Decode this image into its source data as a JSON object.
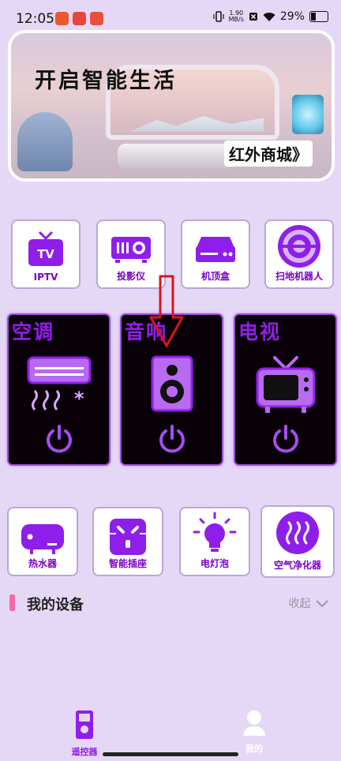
{
  "status": {
    "time": "12:05",
    "net_speed": "1.90",
    "net_unit": "MB/s",
    "battery": "29%"
  },
  "banner": {
    "title": "开启智能生活",
    "mall_link": "红外商城》"
  },
  "top_devices": [
    {
      "label": "IPTV",
      "icon": "tv-box-icon"
    },
    {
      "label": "投影仪",
      "icon": "projector-icon"
    },
    {
      "label": "机顶盒",
      "icon": "set-top-box-icon"
    },
    {
      "label": "扫地机器人",
      "icon": "robot-vacuum-icon"
    }
  ],
  "featured": [
    {
      "title": "空调",
      "icon": "air-conditioner-icon"
    },
    {
      "title": "音响",
      "icon": "speaker-icon"
    },
    {
      "title": "电视",
      "icon": "television-icon"
    }
  ],
  "bottom_devices": [
    {
      "label": "热水器",
      "icon": "water-heater-icon"
    },
    {
      "label": "智能插座",
      "icon": "smart-socket-icon"
    },
    {
      "label": "电灯泡",
      "icon": "light-bulb-icon"
    },
    {
      "label": "空气净化器",
      "icon": "air-purifier-icon"
    }
  ],
  "my_devices": {
    "title": "我的设备",
    "collapse_label": "收起"
  },
  "tabs": [
    {
      "label": "遥控器",
      "active": true
    },
    {
      "label": "我的",
      "active": false
    }
  ],
  "colors": {
    "accent": "#8f1eea",
    "background": "#e5d8f6",
    "card_dark": "#0a0008",
    "pink_marker": "#f06ca7",
    "arrow": "#d9141b"
  }
}
